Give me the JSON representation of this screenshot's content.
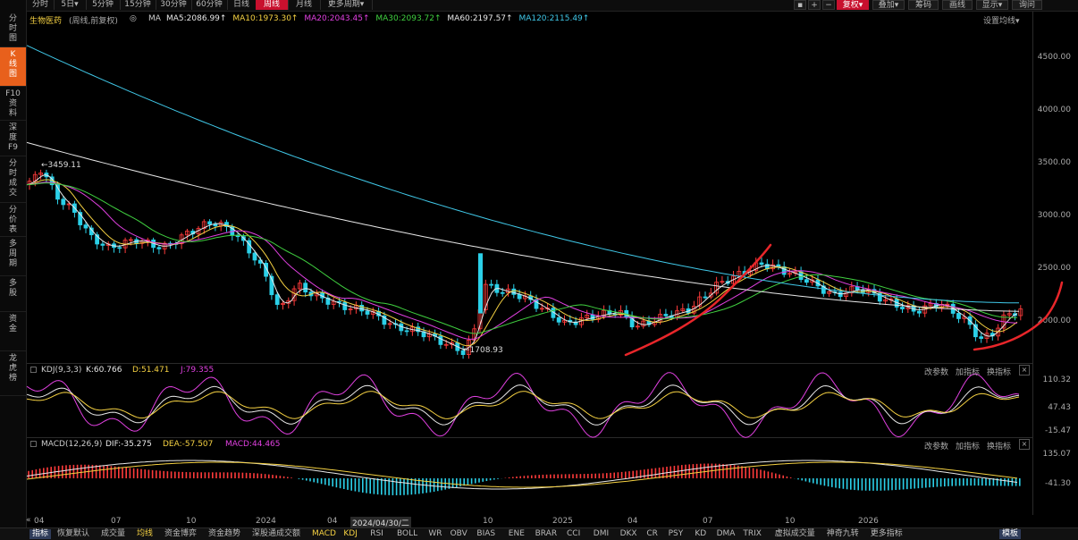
{
  "toolbar": {
    "periods": [
      "分时",
      "5日",
      "5分钟",
      "15分钟",
      "30分钟",
      "60分钟",
      "日线",
      "周线",
      "月线",
      "更多周期"
    ],
    "active_period": 7,
    "right": [
      "+",
      "−",
      "复权",
      "叠加",
      "筹码",
      "画线",
      "显示",
      "询问"
    ]
  },
  "sidebar": [
    {
      "label": "分时图",
      "name": "sidebar-fenshi"
    },
    {
      "label": "K线图",
      "name": "sidebar-kline",
      "active": true
    },
    {
      "label": "F10资料",
      "name": "sidebar-f10"
    },
    {
      "label": "深度F9",
      "name": "sidebar-depth"
    },
    {
      "label": "分时成交",
      "name": "sidebar-trades"
    },
    {
      "label": "分价表",
      "name": "sidebar-price-table"
    },
    {
      "label": "多周期",
      "name": "sidebar-multi-period"
    },
    {
      "label": "多股",
      "name": "sidebar-multi-stock"
    },
    {
      "label": "资金",
      "name": "sidebar-capital"
    },
    {
      "label": "龙虎榜",
      "name": "sidebar-dragon-tiger"
    }
  ],
  "main": {
    "title": "生物医药",
    "subtitle": "(周线,前复权)",
    "ma_label": "MA",
    "ma": [
      {
        "text": "MA5:2086.99",
        "color": "#e8e8e8"
      },
      {
        "text": "MA10:1973.30",
        "color": "#f5d142"
      },
      {
        "text": "MA20:2043.45",
        "color": "#e040e0"
      },
      {
        "text": "MA30:2093.72",
        "color": "#40d040"
      },
      {
        "text": "MA60:2197.57",
        "color": "#e8e8e8"
      },
      {
        "text": "MA120:2115.49",
        "color": "#40c8e8"
      }
    ],
    "settings_label": "设置均线",
    "high_label": "3459.11",
    "low_label": "1708.93",
    "y_ticks": [
      "4500.00",
      "4000.00",
      "3500.00",
      "3000.00",
      "2500.00",
      "2000.00"
    ]
  },
  "kdj": {
    "name": "KDJ(9,3,3)",
    "K": "K:60.766",
    "D": "D:51.471",
    "J": "J:79.355",
    "buttons": [
      "改参数",
      "加指标",
      "换指标"
    ],
    "y_ticks": [
      "110.32",
      "47.43",
      "-15.47"
    ]
  },
  "macd": {
    "name": "MACD(12,26,9)",
    "DIF": "DIF:-35.275",
    "DEA": "DEA:-57.507",
    "MACD": "MACD:44.465",
    "buttons": [
      "改参数",
      "加指标",
      "换指标"
    ],
    "y_ticks": [
      "135.07",
      "-41.30"
    ]
  },
  "x_axis": [
    "04",
    "07",
    "10",
    "2024",
    "04",
    "2024/04/30/二",
    "10",
    "2025",
    "04",
    "07",
    "10",
    "2026"
  ],
  "bottom_tabs": [
    "指标",
    "恢复默认",
    "成交量",
    "均线",
    "资金博弈",
    "资金趋势",
    "深股通成交额",
    "MACD",
    "KDJ",
    "RSI",
    "BOLL",
    "WR",
    "OBV",
    "BIAS",
    "ENE",
    "BRAR",
    "CCI",
    "DMI",
    "DKX",
    "CR",
    "PSY",
    "KD",
    "DMA",
    "TRIX",
    "虚拟成交量",
    "神奇九转",
    "更多指标",
    "模板"
  ],
  "colors": {
    "up": "#ff3b3b",
    "down": "#2bd0e8",
    "accent": "#c8102e"
  }
}
